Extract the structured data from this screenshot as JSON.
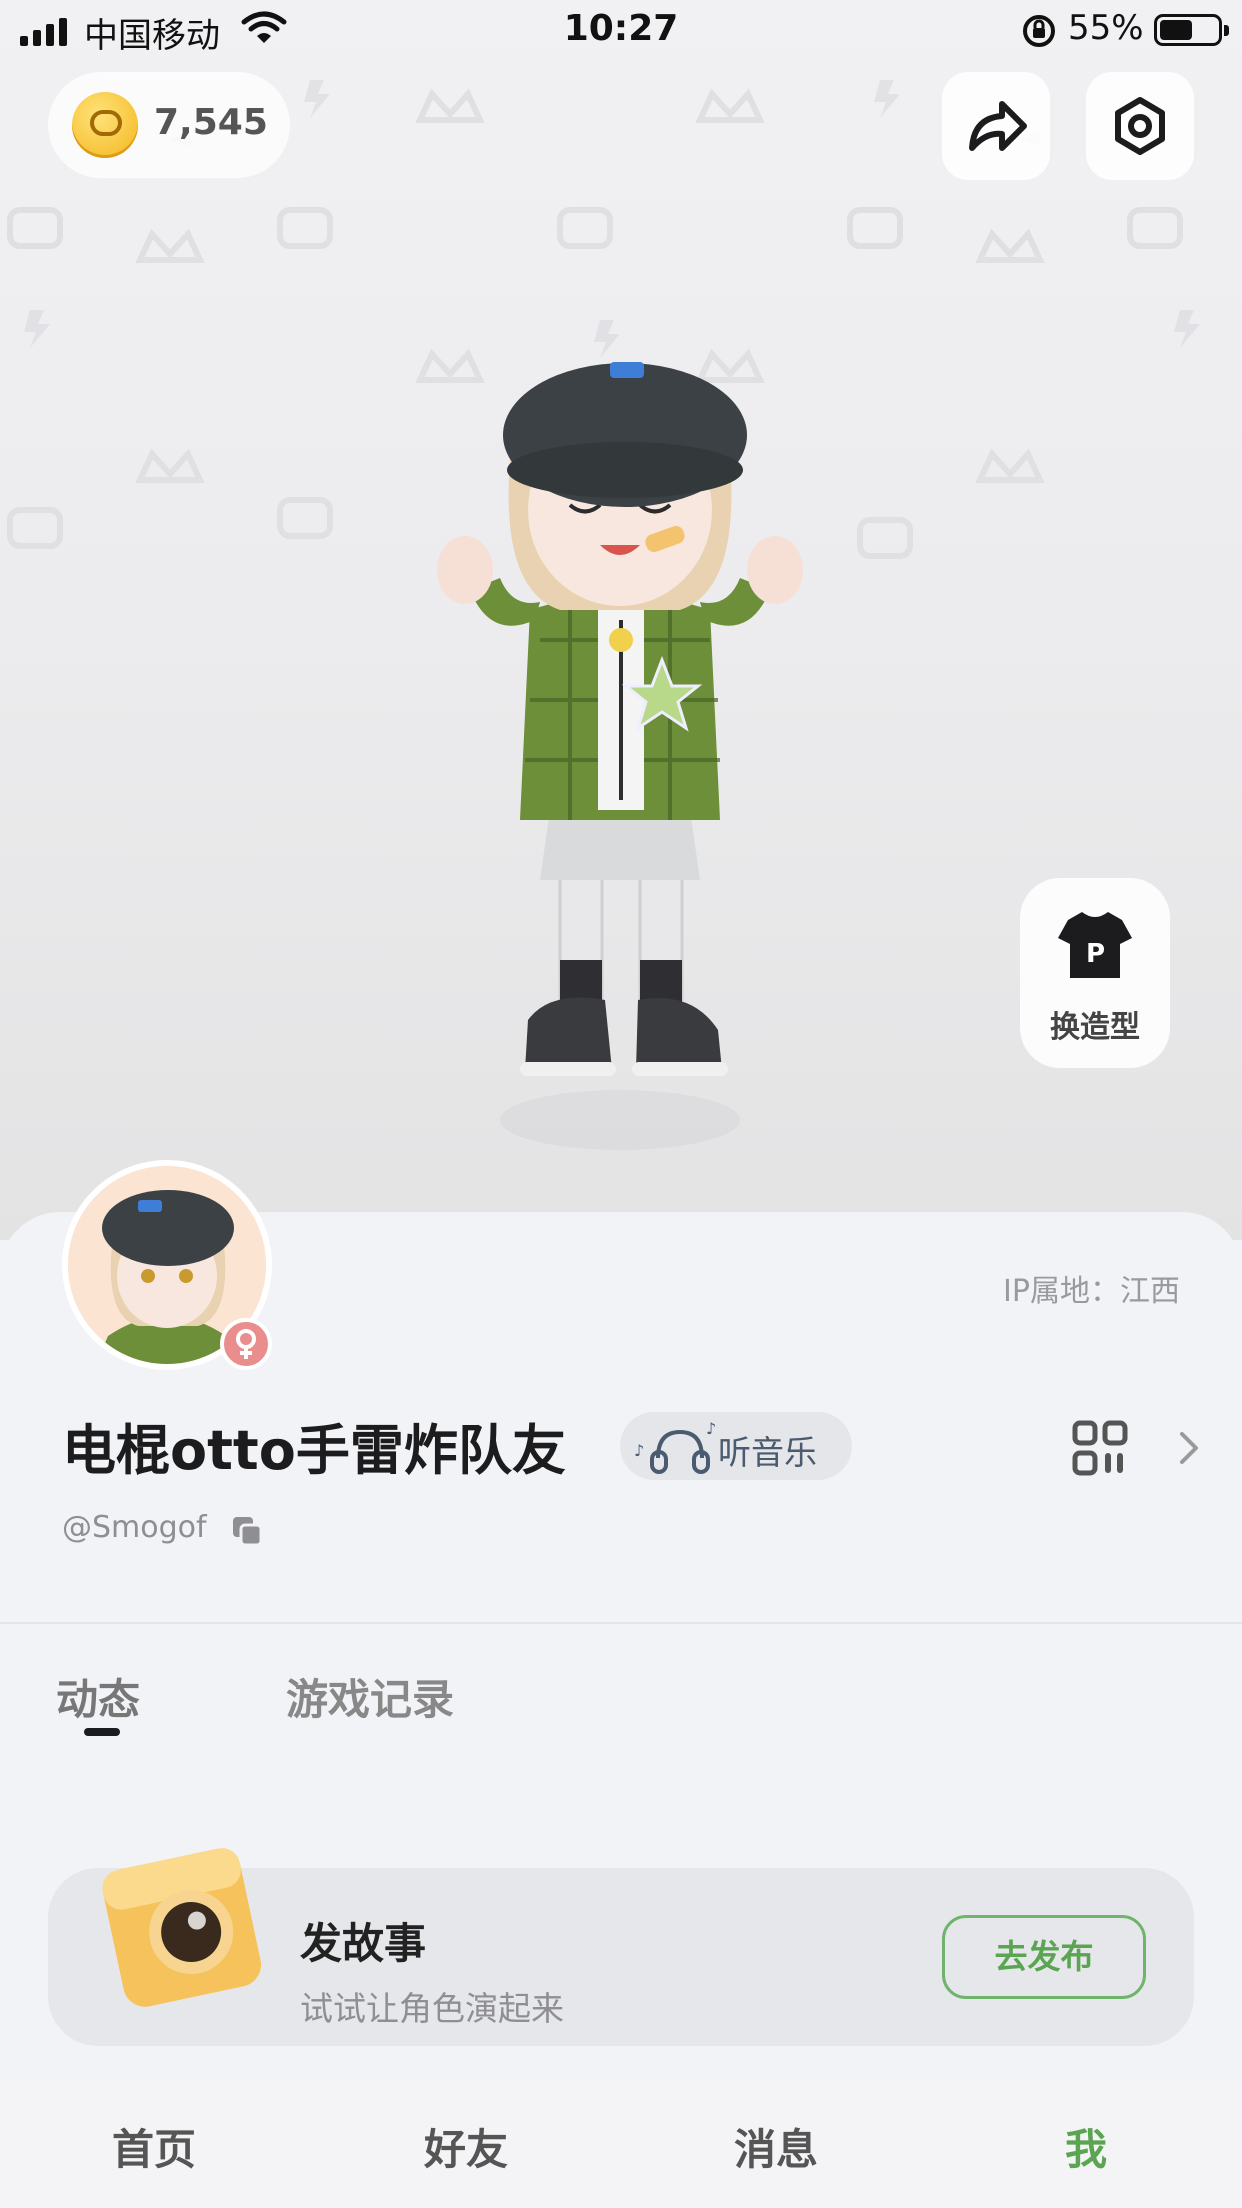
{
  "status_bar": {
    "carrier": "中国移动",
    "time": "10:27",
    "battery_percent": "55%",
    "battery_level": 0.55,
    "icons": [
      "signal-icon",
      "wifi-icon",
      "rotation-lock-icon",
      "battery-icon"
    ]
  },
  "header": {
    "coin_balance": "7,545",
    "coin_icon": "coin-icon",
    "share_icon": "share-icon",
    "settings_icon": "settings-icon"
  },
  "outfit": {
    "label": "换造型",
    "icon": "tshirt-icon"
  },
  "profile": {
    "ip_location": "IP属地：江西",
    "nickname": "电棍otto手雷炸队友",
    "status_tag": "听音乐",
    "status_icon": "headphones-icon",
    "handle": "@Smogof",
    "gender": "female"
  },
  "tabs": [
    {
      "label": "动态",
      "active": true
    },
    {
      "label": "游戏记录",
      "active": false
    }
  ],
  "story_card": {
    "title": "发故事",
    "subtitle": "试试让角色演起来",
    "button": "去发布",
    "icon": "camera-icon"
  },
  "bottom_nav": [
    {
      "label": "首页",
      "active": false
    },
    {
      "label": "好友",
      "active": false
    },
    {
      "label": "消息",
      "active": false
    },
    {
      "label": "我",
      "active": true
    }
  ],
  "colors": {
    "accent_green": "#5aa452",
    "coin_gold": "#f3b51c",
    "gender_pink": "#e98d8d",
    "background": "#f2f3f7"
  }
}
